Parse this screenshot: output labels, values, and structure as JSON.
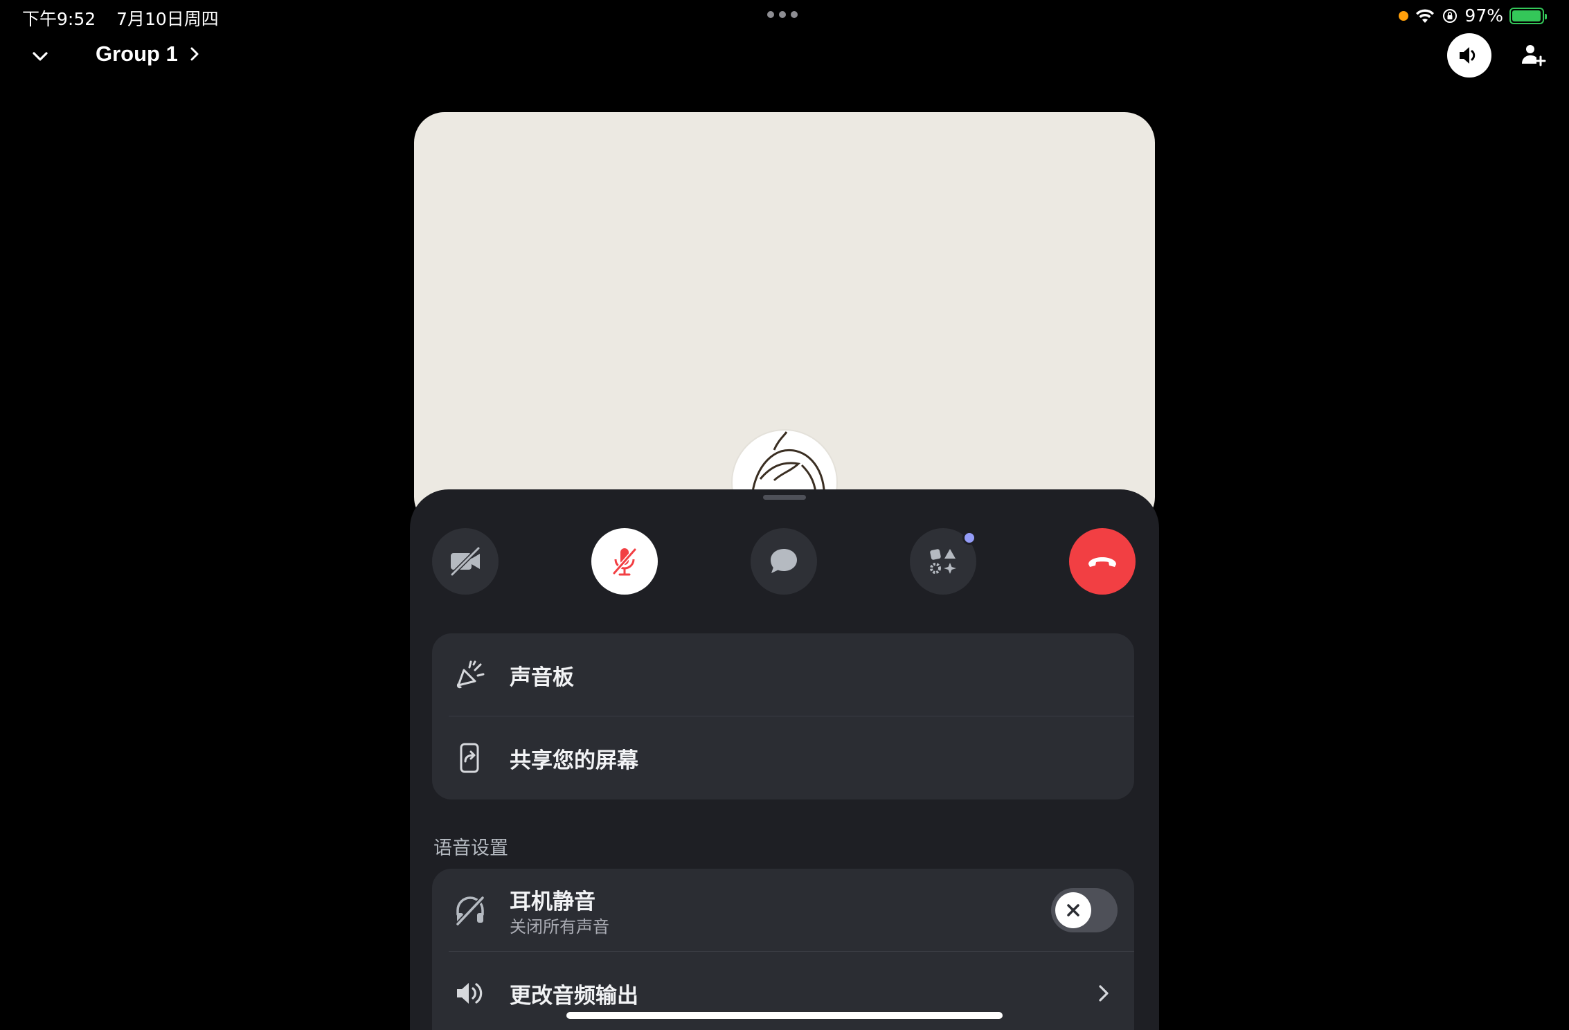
{
  "status_bar": {
    "time": "下午9:52",
    "date": "7月10日周四",
    "battery_text": "97%",
    "battery_level": 0.97
  },
  "header": {
    "title": "Group 1"
  },
  "controls": {
    "camera_icon": "camera-off-icon",
    "mic_icon": "mic-muted-icon",
    "chat_icon": "chat-bubble-icon",
    "activities_icon": "activities-icon",
    "end_call_icon": "phone-hangup-icon"
  },
  "menu": {
    "soundboard_label": "声音板",
    "share_screen_label": "共享您的屏幕"
  },
  "voice_settings": {
    "section_title": "语音设置",
    "deafen_label": "耳机静音",
    "deafen_sub": "关闭所有声音",
    "deafen_enabled": false,
    "audio_output_label": "更改音频输出"
  },
  "colors": {
    "accent_red": "#f23f43",
    "notify_dot": "#949cf7",
    "sheet_bg": "#1e1f24",
    "card_bg": "#2b2d33",
    "tile_bg": "#ece9e2"
  }
}
